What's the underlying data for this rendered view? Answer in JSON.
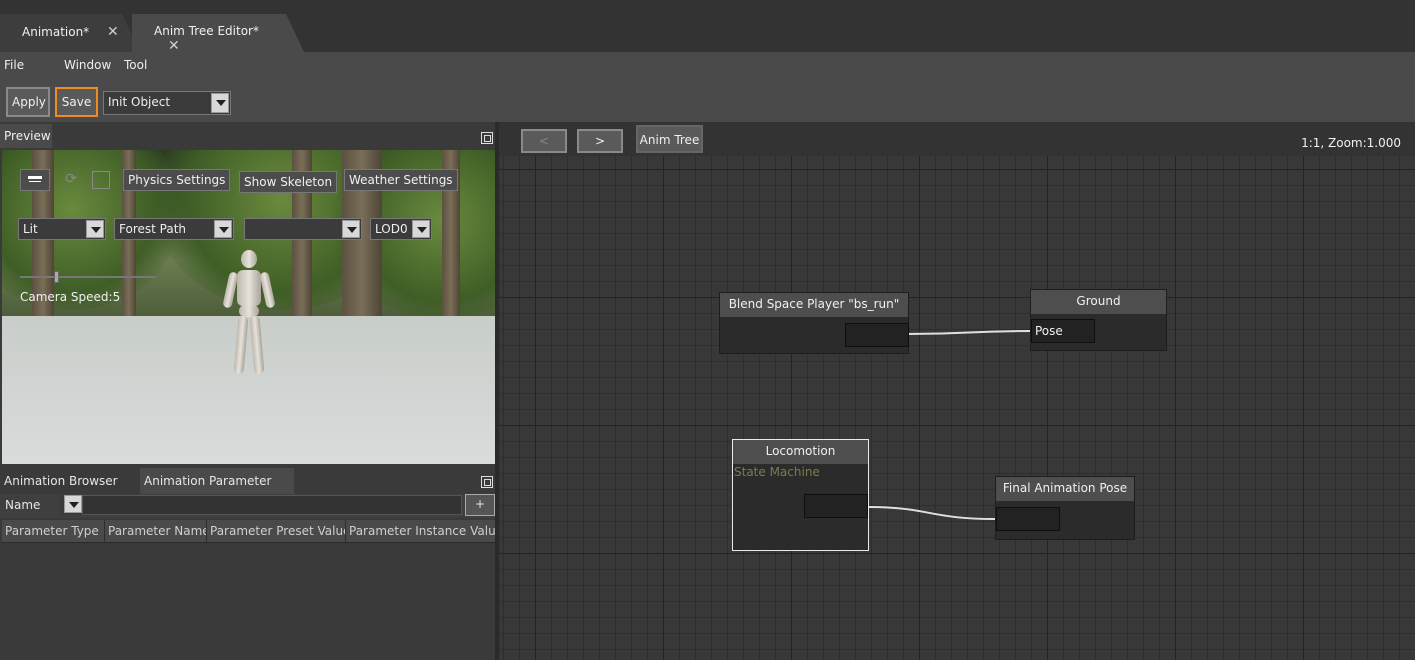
{
  "tabs": [
    {
      "label": "Animation*"
    },
    {
      "label": "Anim Tree Editor*"
    }
  ],
  "menu": {
    "file": "File",
    "window": "Window",
    "tool": "Tool"
  },
  "toolbar": {
    "apply": "Apply",
    "save": "Save",
    "object_combo": "Init Object"
  },
  "preview": {
    "title": "Preview",
    "physics_settings": "Physics Settings",
    "show_skeleton": "Show Skeleton",
    "weather_settings": "Weather Settings",
    "lighting_mode": "Lit",
    "environment": "Forest Path",
    "blank_combo": "",
    "lod": "LOD0",
    "camera_speed": "Camera Speed:5",
    "camera_speed_value": 5
  },
  "bottom_panel": {
    "tabs": [
      {
        "label": "Animation Browser"
      },
      {
        "label": "Animation Parameter"
      }
    ],
    "filter_combo": "Name",
    "add_button": "+",
    "columns": [
      "Parameter Type",
      "Parameter Name",
      "Parameter Preset Value",
      "Parameter Instance Value"
    ]
  },
  "graph": {
    "back_button": "<",
    "forward_button": ">",
    "breadcrumb": "Anim Tree",
    "zoom_readout": "1:1, Zoom:1.000",
    "nodes": {
      "blend_space": {
        "title": "Blend Space Player \"bs_run\""
      },
      "ground": {
        "title": "Ground",
        "pin": "Pose"
      },
      "locomotion": {
        "title": "Locomotion",
        "subtitle": "State Machine"
      },
      "final_pose": {
        "title": "Final Animation Pose"
      }
    }
  },
  "colors": {
    "accent": "#f08a24",
    "state_machine_text": "#7d7a4e",
    "wire": "#e0e0e0"
  }
}
